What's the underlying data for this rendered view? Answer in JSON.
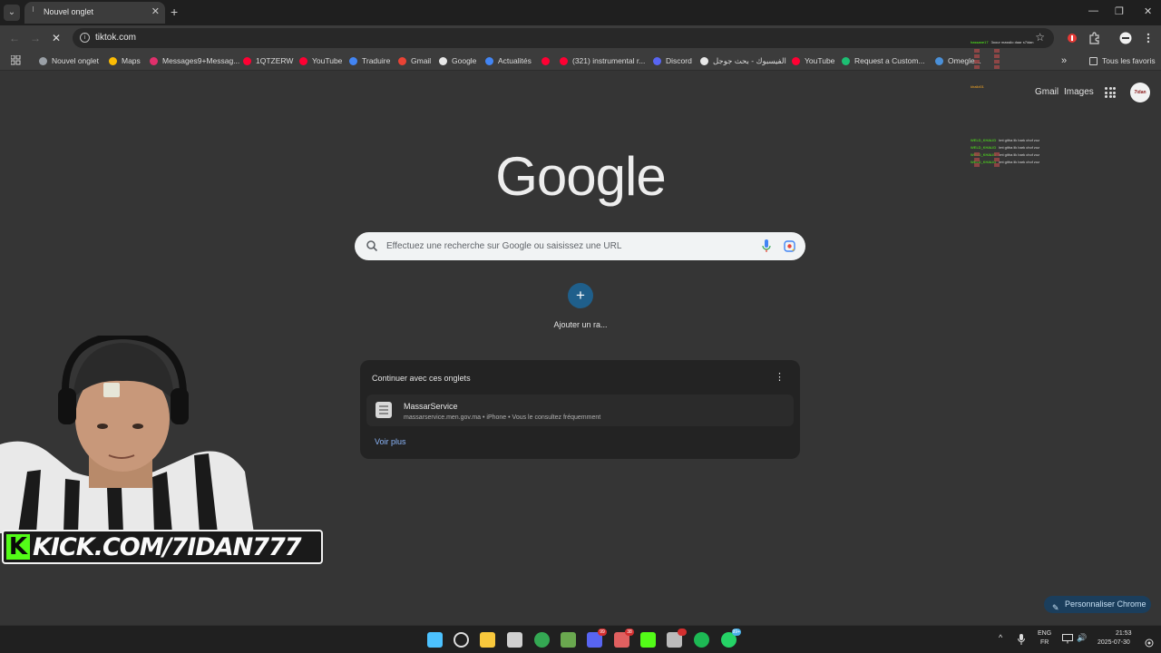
{
  "tabs": [
    {
      "title": "Nouvel onglet",
      "close": "✕"
    }
  ],
  "tab_list_glyph": "⌄",
  "new_tab_glyph": "+",
  "window_controls": {
    "minimize": "—",
    "restore": "❐",
    "close": "✕"
  },
  "toolbar": {
    "back": "←",
    "forward": "→",
    "reload": "✕",
    "info_glyph": "i",
    "address": "tiktok.com",
    "star": "☆"
  },
  "bookmarks": [
    {
      "label": "Nouvel onglet",
      "icon": "chrome-icon",
      "color": "#9aa0a6"
    },
    {
      "label": "Maps",
      "icon": "maps-pin-icon",
      "color": "#fbbc04"
    },
    {
      "label": "Messages9+Messag...",
      "icon": "instagram-icon",
      "color": "#e1306c"
    },
    {
      "label": "1QTZERW",
      "icon": "youtube-icon",
      "color": "#ff0033"
    },
    {
      "label": "YouTube",
      "icon": "youtube-icon",
      "color": "#ff0033"
    },
    {
      "label": "Traduire",
      "icon": "translate-icon",
      "color": "#4285f4"
    },
    {
      "label": "Gmail",
      "icon": "gmail-icon",
      "color": "#ea4335"
    },
    {
      "label": "Google",
      "icon": "google-icon",
      "color": "#e8e8e8"
    },
    {
      "label": "Actualités",
      "icon": "news-icon",
      "color": "#4285f4"
    },
    {
      "label": "",
      "icon": "youtube-icon",
      "color": "#ff0033"
    },
    {
      "label": "(321) instrumental r...",
      "icon": "youtube-icon",
      "color": "#ff0033"
    },
    {
      "label": "Discord",
      "icon": "discord-icon",
      "color": "#5865f2"
    },
    {
      "label": "الفيسبوك - بحث جوجل",
      "icon": "google-icon",
      "color": "#e8e8e8"
    },
    {
      "label": "YouTube",
      "icon": "youtube-icon",
      "color": "#ff0033"
    },
    {
      "label": "Request a Custom...",
      "icon": "fiverr-icon",
      "color": "#1dbf73"
    },
    {
      "label": "Omegle...",
      "icon": "omegle-icon",
      "color": "#4a90d9"
    }
  ],
  "bookmarks_overflow": "»",
  "all_bookmarks": "Tous les favoris",
  "top_links": {
    "gmail": "Gmail",
    "images": "Images"
  },
  "avatar_text": "7idan",
  "logo": "Google",
  "search": {
    "placeholder": "Effectuez une recherche sur Google ou saisissez une URL"
  },
  "shortcut": {
    "plus": "+",
    "label": "Ajouter un ra..."
  },
  "continue_card": {
    "title": "Continuer avec ces onglets",
    "menu_glyph": "⋮",
    "items": [
      {
        "title": "MassarService",
        "subtitle": "massarservice.men.gov.ma • iPhone • Vous le consultez fréquemment"
      }
    ],
    "more": "Voir plus"
  },
  "webcam_banner": {
    "k": "K",
    "text": "KICK.COM/7IDAN777"
  },
  "chat": [
    {
      "user": "hassane17",
      "text": "3oour massilo daar s7idan",
      "color": "#53fc18"
    },
    {
      "user": "khalid01",
      "text": "",
      "color": "#f5a623"
    },
    {
      "user": "WELD_KHALID",
      "text": "lmt githa lik bark chof zoz",
      "color": "#53fc18"
    },
    {
      "user": "WELD_KHALID",
      "text": "lmt githa lik bark chof zoz",
      "color": "#53fc18"
    },
    {
      "user": "WELD_KHALID",
      "text": "lmt githa lik bark chof zoz",
      "color": "#53fc18"
    },
    {
      "user": "WELD_KHALID",
      "text": "lmt githa lik bark chof zoz",
      "color": "#53fc18"
    }
  ],
  "customize": {
    "label": "Personnaliser Chrome",
    "icon": "pencil-icon",
    "glyph": "✎"
  },
  "taskbar": {
    "apps": [
      {
        "name": "start-icon",
        "color": "#4cc2ff"
      },
      {
        "name": "search-icon",
        "color": "#dcdcdc"
      },
      {
        "name": "file-explorer-icon",
        "color": "#f8c83c"
      },
      {
        "name": "store-icon",
        "color": "#d0d0d0"
      },
      {
        "name": "chrome-icon",
        "color": "#34a853"
      },
      {
        "name": "minecraft-icon",
        "color": "#6aa84f"
      },
      {
        "name": "discord-icon",
        "color": "#5865f2",
        "badge": "99"
      },
      {
        "name": "streaming-app-icon",
        "color": "#e06060",
        "badge": "38"
      },
      {
        "name": "kick-icon",
        "color": "#53fc18"
      },
      {
        "name": "obs-icon",
        "color": "#bbbbbb",
        "badge": ""
      },
      {
        "name": "spotify-icon",
        "color": "#1db954"
      },
      {
        "name": "whatsapp-icon",
        "color": "#25d366",
        "badge": "99+"
      }
    ],
    "lang": "ENG",
    "lang_sub": "FR",
    "time": "21:53",
    "date": "2025-07-30",
    "tray_up": "^",
    "speaker": "🔊"
  }
}
